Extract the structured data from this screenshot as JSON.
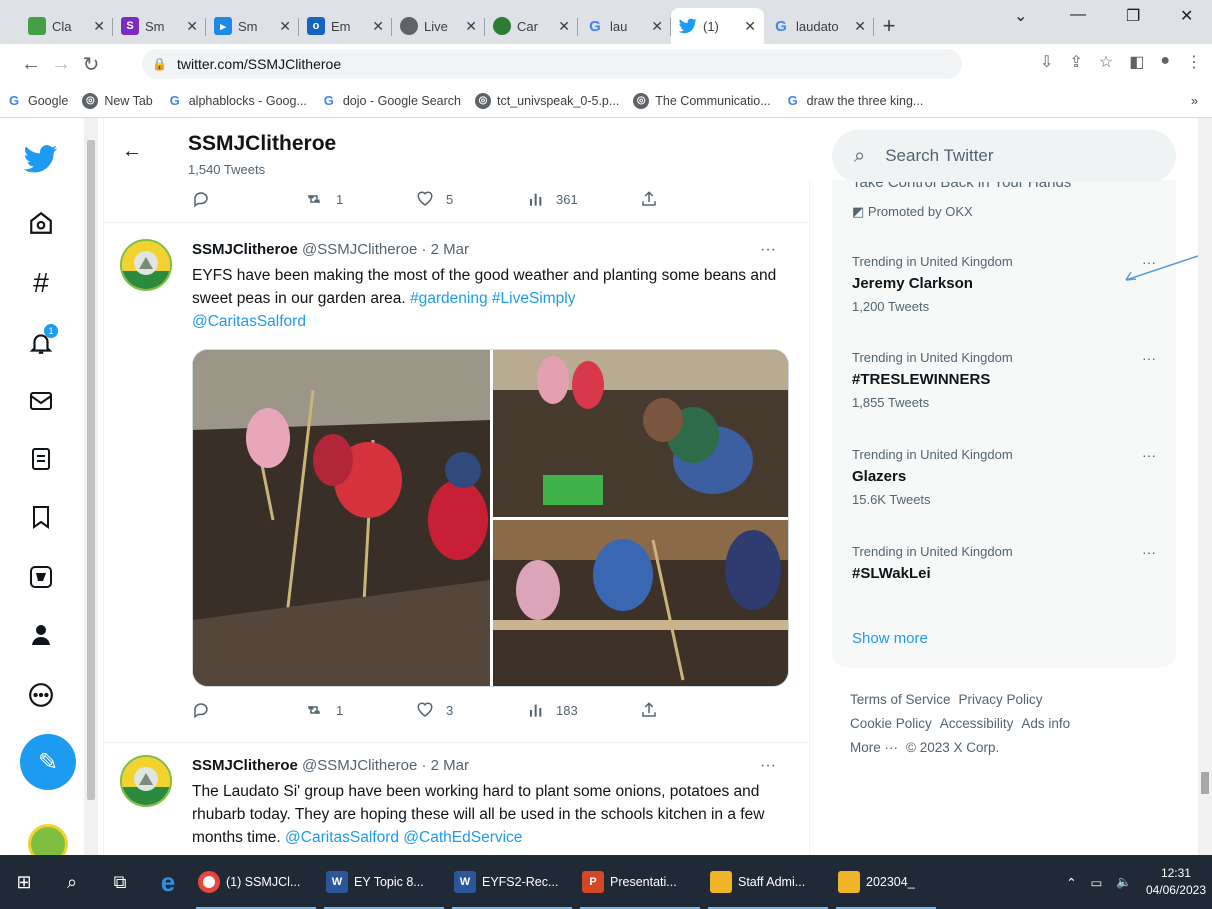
{
  "browser": {
    "tabs": [
      {
        "title": "Cla",
        "color": "#43a047"
      },
      {
        "title": "Sm",
        "color": "#7b2cbf"
      },
      {
        "title": "Sm",
        "color": "#1e88e5"
      },
      {
        "title": "Em",
        "color": "#1565c0"
      },
      {
        "title": "Live",
        "color": "#5f6368"
      },
      {
        "title": "Car",
        "color": "#2e7d32"
      },
      {
        "title": "lau",
        "color": "#4285f4"
      },
      {
        "title": "(1)",
        "color": "#1d9bf0"
      },
      {
        "title": "laudato",
        "color": "#4285f4"
      }
    ],
    "url": "twitter.com/SSMJClitheroe",
    "bookmarks": [
      "Google",
      "New Tab",
      "alphablocks - Goog...",
      "dojo - Google Search",
      "tct_univspeak_0-5.p...",
      "The Communicatio...",
      "draw the three king..."
    ],
    "bookmarks_overflow": "»"
  },
  "header": {
    "name": "SSMJClitheroe",
    "tweet_count": "1,540 Tweets"
  },
  "prev_tweet_actions": {
    "reply": "",
    "retweet": "1",
    "like": "5",
    "views": "361"
  },
  "tweets": [
    {
      "name": "SSMJClitheroe",
      "handle_time": "@SSMJClitheroe · 2 Mar",
      "text": "EYFS have been making the most of the good weather and planting some beans and sweet peas in our garden area.",
      "links": "#gardening #LiveSimply",
      "link2": "@CaritasSalford",
      "actions": {
        "reply": "",
        "retweet": "1",
        "like": "3",
        "views": "183"
      }
    },
    {
      "name": "SSMJClitheroe",
      "handle_time": "@SSMJClitheroe · 2 Mar",
      "text": "The Laudato Si' group have been working hard to plant some onions, potatoes and rhubarb today. They are hoping these will all be used in the schools kitchen in a few months time.",
      "links": "@CaritasSalford @CathEdService"
    }
  ],
  "sidebar": {
    "search_placeholder": "Search Twitter",
    "promo_cut": "Take Control Back in Your Hands",
    "promoted_by": "Promoted by OKX",
    "trends": [
      {
        "context": "Trending in United Kingdom",
        "topic": "Jeremy Clarkson",
        "count": "1,200 Tweets"
      },
      {
        "context": "Trending in United Kingdom",
        "topic": "#TRESLEWINNERS",
        "count": "1,855 Tweets"
      },
      {
        "context": "Trending in United Kingdom",
        "topic": "Glazers",
        "count": "15.6K Tweets"
      },
      {
        "context": "Trending in United Kingdom",
        "topic": "#SLWakLei",
        "count": ""
      }
    ],
    "show_more": "Show more",
    "footer": {
      "line1": [
        "Terms of Service",
        "Privacy Policy"
      ],
      "line2": [
        "Cookie Policy",
        "Accessibility",
        "Ads info"
      ],
      "more": "More ···",
      "copyright": "© 2023 X Corp."
    }
  },
  "taskbar": {
    "apps": [
      {
        "label": "(1) SSMJCl...",
        "icon": "chrome-icon"
      },
      {
        "label": "EY Topic 8...",
        "icon": "word-icon"
      },
      {
        "label": "EYFS2-Rec...",
        "icon": "word-icon"
      },
      {
        "label": "Presentati...",
        "icon": "powerpoint-icon"
      },
      {
        "label": "Staff Admi...",
        "icon": "folder-icon"
      },
      {
        "label": "202304_",
        "icon": "folder-icon"
      }
    ],
    "time": "12:31",
    "date": "04/06/2023"
  }
}
